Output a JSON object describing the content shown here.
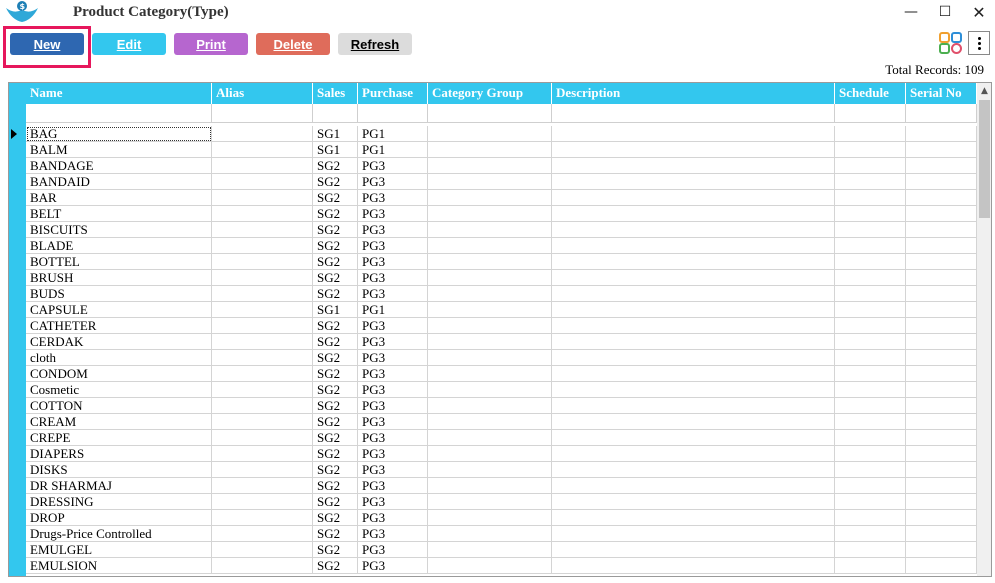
{
  "window": {
    "title": "Product Category(Type)",
    "minimize_glyph": "—",
    "maximize_glyph": "☐",
    "close_glyph": "✕"
  },
  "toolbar": {
    "new_label": "New",
    "edit_label": "Edit",
    "print_label": "Print",
    "delete_label": "Delete",
    "refresh_label": "Refresh",
    "colors": {
      "new": "#2e67b1",
      "edit": "#33c7ee",
      "print": "#b666cf",
      "delete": "#df6c5b",
      "refresh": "#dcdcdc",
      "highlight": "#e6175c"
    },
    "icons": [
      "grid-layout-icon",
      "more-vertical-icon"
    ]
  },
  "summary": {
    "total_records": "Total Records: 109"
  },
  "grid": {
    "header_color": "#33c7ee",
    "columns": [
      {
        "key": "name",
        "label": "Name"
      },
      {
        "key": "alias",
        "label": "Alias"
      },
      {
        "key": "sales",
        "label": "Sales"
      },
      {
        "key": "purchase",
        "label": "Purchase"
      },
      {
        "key": "category_group",
        "label": "Category Group"
      },
      {
        "key": "description",
        "label": "Description"
      },
      {
        "key": "schedule",
        "label": "Schedule"
      },
      {
        "key": "serial_no",
        "label": "Serial No"
      }
    ],
    "rows": [
      {
        "name": "BAG",
        "alias": "",
        "sales": "SG1",
        "purchase": "PG1"
      },
      {
        "name": "BALM",
        "alias": "",
        "sales": "SG1",
        "purchase": "PG1"
      },
      {
        "name": "BANDAGE",
        "alias": "",
        "sales": "SG2",
        "purchase": "PG3"
      },
      {
        "name": "BANDAID",
        "alias": "",
        "sales": "SG2",
        "purchase": "PG3"
      },
      {
        "name": "BAR",
        "alias": "",
        "sales": "SG2",
        "purchase": "PG3"
      },
      {
        "name": "BELT",
        "alias": "",
        "sales": "SG2",
        "purchase": "PG3"
      },
      {
        "name": "BISCUITS",
        "alias": "",
        "sales": "SG2",
        "purchase": "PG3"
      },
      {
        "name": "BLADE",
        "alias": "",
        "sales": "SG2",
        "purchase": "PG3"
      },
      {
        "name": "BOTTEL",
        "alias": "",
        "sales": "SG2",
        "purchase": "PG3"
      },
      {
        "name": "BRUSH",
        "alias": "",
        "sales": "SG2",
        "purchase": "PG3"
      },
      {
        "name": "BUDS",
        "alias": "",
        "sales": "SG2",
        "purchase": "PG3"
      },
      {
        "name": "CAPSULE",
        "alias": "",
        "sales": "SG1",
        "purchase": "PG1"
      },
      {
        "name": "CATHETER",
        "alias": "",
        "sales": "SG2",
        "purchase": "PG3"
      },
      {
        "name": "CERDAK",
        "alias": "",
        "sales": "SG2",
        "purchase": "PG3"
      },
      {
        "name": "cloth",
        "alias": "",
        "sales": "SG2",
        "purchase": "PG3"
      },
      {
        "name": "CONDOM",
        "alias": "",
        "sales": "SG2",
        "purchase": "PG3"
      },
      {
        "name": "Cosmetic",
        "alias": "",
        "sales": "SG2",
        "purchase": "PG3"
      },
      {
        "name": "COTTON",
        "alias": "",
        "sales": "SG2",
        "purchase": "PG3"
      },
      {
        "name": "CREAM",
        "alias": "",
        "sales": "SG2",
        "purchase": "PG3"
      },
      {
        "name": "CREPE",
        "alias": "",
        "sales": "SG2",
        "purchase": "PG3"
      },
      {
        "name": "DIAPERS",
        "alias": "",
        "sales": "SG2",
        "purchase": "PG3"
      },
      {
        "name": "DISKS",
        "alias": "",
        "sales": "SG2",
        "purchase": "PG3"
      },
      {
        "name": "DR SHARMAJ",
        "alias": "",
        "sales": "SG2",
        "purchase": "PG3"
      },
      {
        "name": "DRESSING",
        "alias": "",
        "sales": "SG2",
        "purchase": "PG3"
      },
      {
        "name": "DROP",
        "alias": "",
        "sales": "SG2",
        "purchase": "PG3"
      },
      {
        "name": "Drugs-Price Controlled",
        "alias": "",
        "sales": "SG2",
        "purchase": "PG3"
      },
      {
        "name": "EMULGEL",
        "alias": "",
        "sales": "SG2",
        "purchase": "PG3"
      },
      {
        "name": "EMULSION",
        "alias": "",
        "sales": "SG2",
        "purchase": "PG3"
      }
    ]
  }
}
